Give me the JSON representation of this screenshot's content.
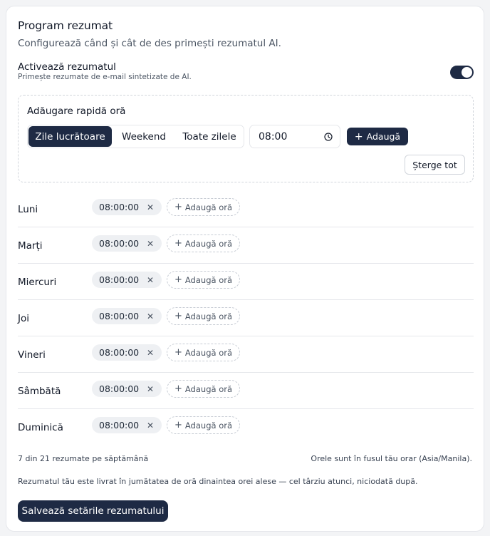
{
  "header": {
    "title": "Program rezumat",
    "subtitle": "Configurează când și cât de des primești rezumatul AI."
  },
  "toggle": {
    "label": "Activează rezumatul",
    "description": "Primește rezumate de e-mail sintetizate de AI.",
    "enabled": true
  },
  "quick_add": {
    "title": "Adăugare rapidă oră",
    "options": [
      "Zile lucrătoare",
      "Weekend",
      "Toate zilele"
    ],
    "selected": "Zile lucrătoare",
    "time_value": "08:00",
    "add_label": "Adaugă",
    "clear_label": "Șterge tot"
  },
  "days": [
    {
      "name": "Luni",
      "times": [
        "08:00:00"
      ]
    },
    {
      "name": "Marți",
      "times": [
        "08:00:00"
      ]
    },
    {
      "name": "Miercuri",
      "times": [
        "08:00:00"
      ]
    },
    {
      "name": "Joi",
      "times": [
        "08:00:00"
      ]
    },
    {
      "name": "Vineri",
      "times": [
        "08:00:00"
      ]
    },
    {
      "name": "Sâmbătă",
      "times": [
        "08:00:00"
      ]
    },
    {
      "name": "Duminică",
      "times": [
        "08:00:00"
      ]
    }
  ],
  "add_time_label": "Adaugă oră",
  "footer": {
    "count": "7 din 21 rezumate pe săptămână",
    "timezone_note": "Orele sunt în fusul tău orar (Asia/Manila).",
    "delivery_note": "Rezumatul tău este livrat în jumătatea de oră dinaintea orei alese — cel târziu atunci, niciodată după.",
    "save_label": "Salvează setările rezumatului"
  },
  "colors": {
    "primary": "#1e2a44",
    "border": "#e5e7eb",
    "chip_bg": "#eef0f3"
  }
}
